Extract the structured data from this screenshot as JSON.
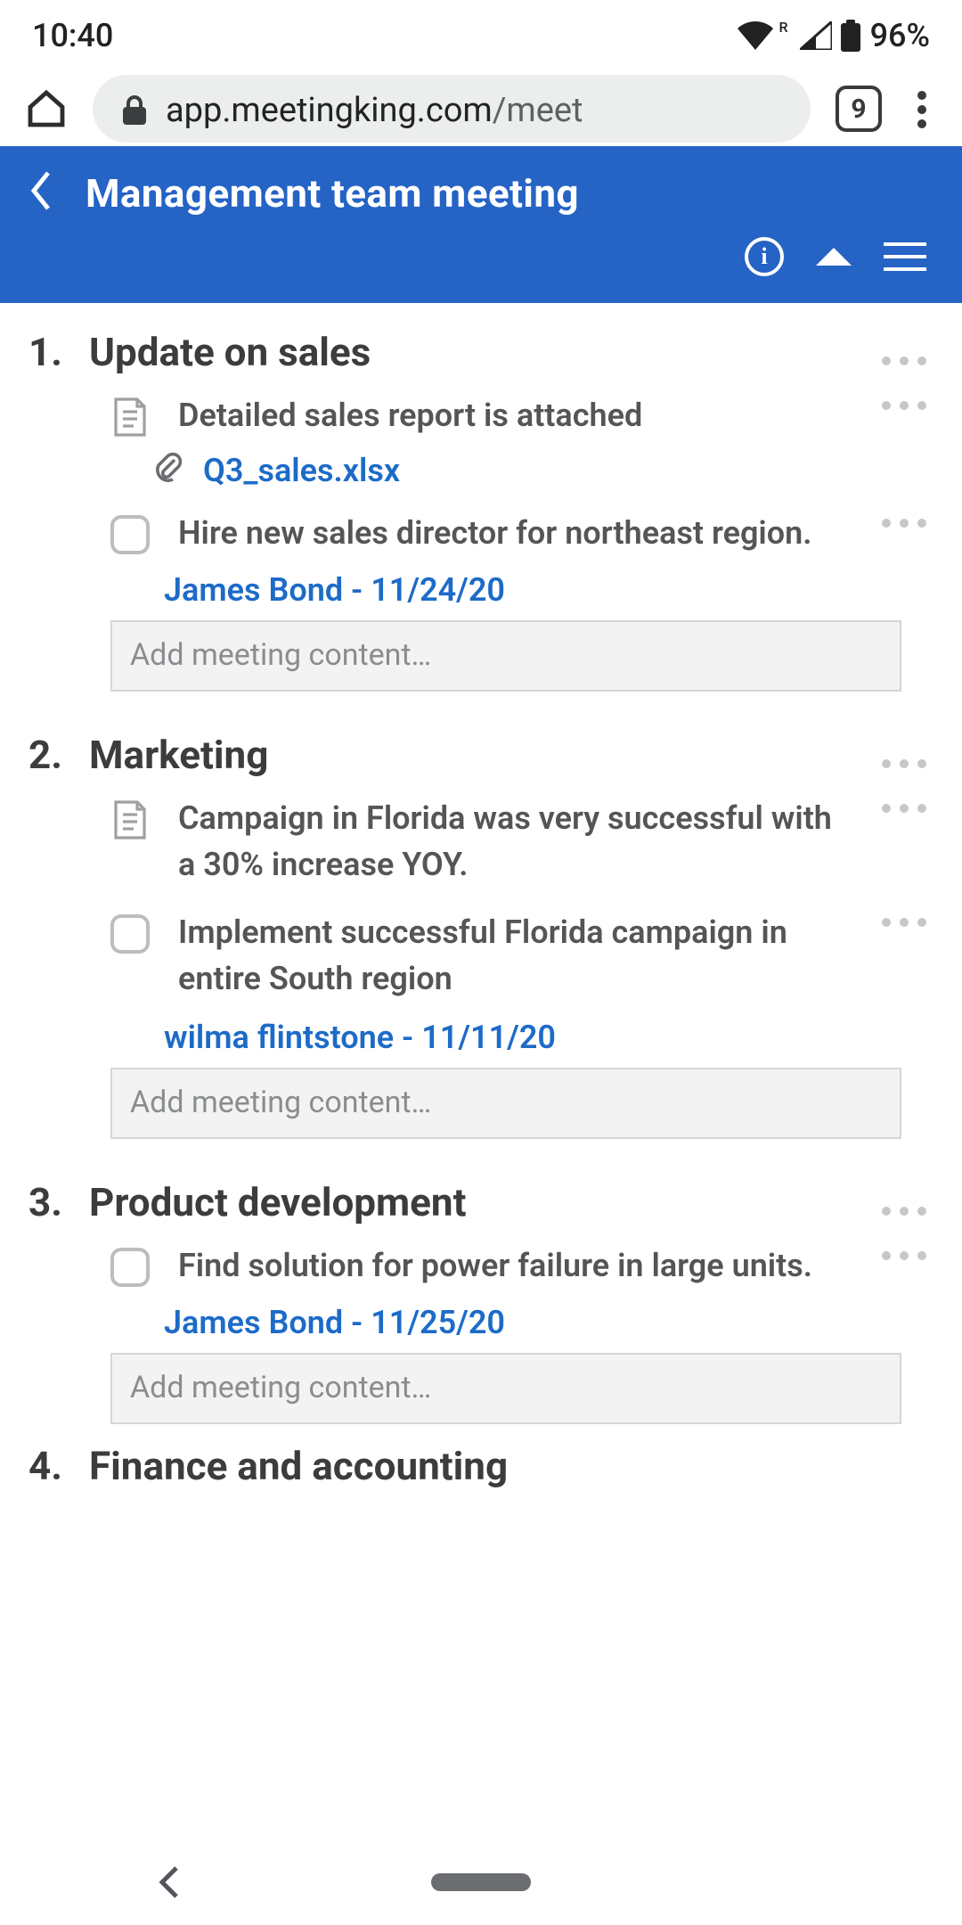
{
  "status": {
    "time": "10:40",
    "network_badge": "R",
    "battery": "96%"
  },
  "chrome": {
    "url_host": "app.meetingking.com",
    "url_path": "/meet",
    "tab_count": "9"
  },
  "header": {
    "title": "Management team meeting"
  },
  "add_content_placeholder": "Add meeting content…",
  "sections": [
    {
      "num": "1.",
      "title": "Update on sales",
      "items": [
        {
          "kind": "note",
          "text": "Detailed sales report is attached",
          "attachment": "Q3_sales.xlsx"
        },
        {
          "kind": "task",
          "text": "Hire new sales director for northeast region.",
          "owner": "James Bond",
          "due": "11/24/20"
        }
      ]
    },
    {
      "num": "2.",
      "title": "Marketing",
      "items": [
        {
          "kind": "note",
          "text": "Campaign in Florida was very successful with a 30% increase YOY."
        },
        {
          "kind": "task",
          "text": "Implement successful Florida campaign in entire South region",
          "owner": "wilma flintstone",
          "due": "11/11/20"
        }
      ]
    },
    {
      "num": "3.",
      "title": "Product development",
      "items": [
        {
          "kind": "task",
          "text": "Find solution for power failure in large units.",
          "owner": "James Bond",
          "due": "11/25/20"
        }
      ]
    }
  ],
  "cutoff": {
    "num": "4.",
    "title": "Finance and accounting"
  }
}
